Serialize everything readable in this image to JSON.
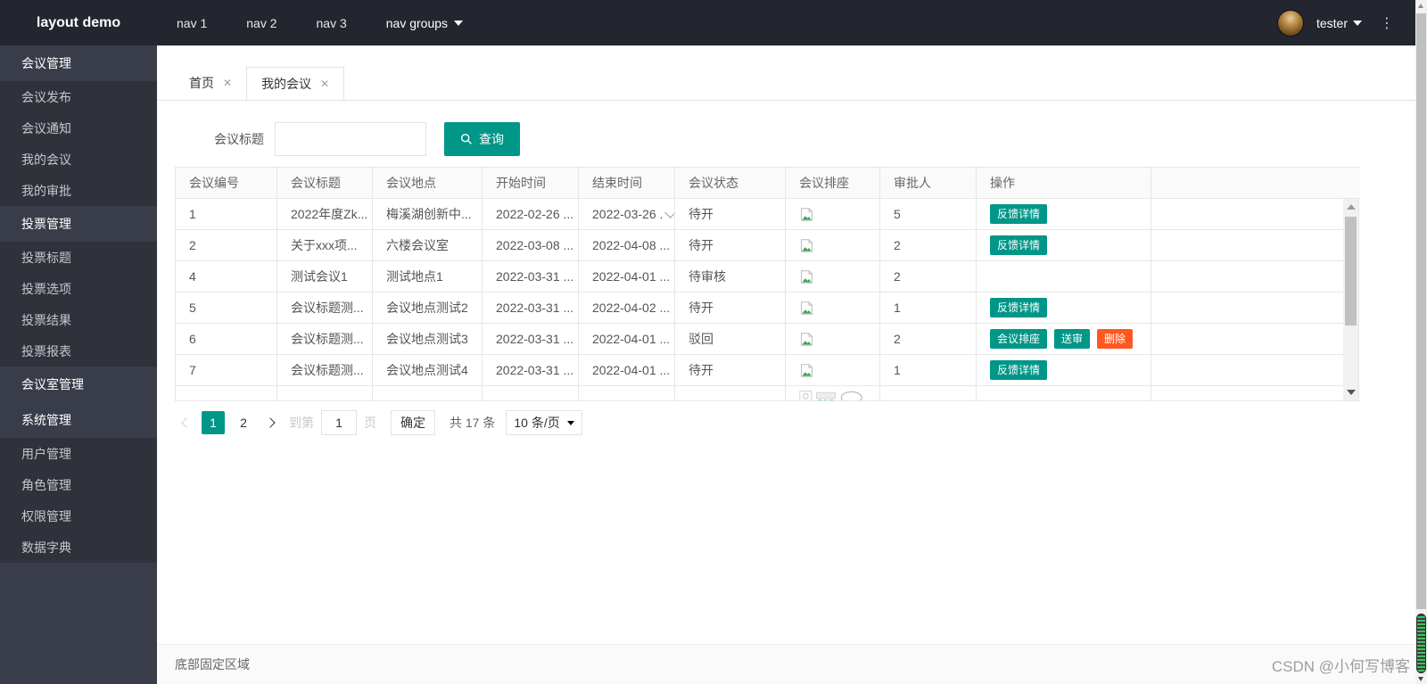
{
  "app": {
    "title": "layout demo"
  },
  "topnav": {
    "items": [
      "nav 1",
      "nav 2",
      "nav 3"
    ],
    "group_label": "nav groups",
    "user_name": "tester",
    "more_icon": "vertical-ellipsis"
  },
  "sidebar": {
    "items": [
      {
        "label": "会议管理",
        "type": "parent"
      },
      {
        "label": "会议发布",
        "type": "child"
      },
      {
        "label": "会议通知",
        "type": "child"
      },
      {
        "label": "我的会议",
        "type": "child"
      },
      {
        "label": "我的审批",
        "type": "child"
      },
      {
        "label": "投票管理",
        "type": "parent"
      },
      {
        "label": "投票标题",
        "type": "child"
      },
      {
        "label": "投票选项",
        "type": "child"
      },
      {
        "label": "投票结果",
        "type": "child"
      },
      {
        "label": "投票报表",
        "type": "child"
      },
      {
        "label": "会议室管理",
        "type": "parent"
      },
      {
        "label": "系统管理",
        "type": "parent"
      },
      {
        "label": "用户管理",
        "type": "child"
      },
      {
        "label": "角色管理",
        "type": "child"
      },
      {
        "label": "权限管理",
        "type": "child"
      },
      {
        "label": "数据字典",
        "type": "child"
      }
    ]
  },
  "tabs": [
    {
      "label": "首页",
      "active": false
    },
    {
      "label": "我的会议",
      "active": true
    }
  ],
  "search": {
    "label": "会议标题",
    "value": "",
    "button_label": "查询"
  },
  "table": {
    "columns": [
      "会议编号",
      "会议标题",
      "会议地点",
      "开始时间",
      "结束时间",
      "会议状态",
      "会议排座",
      "审批人",
      "操作",
      ""
    ],
    "rows": [
      {
        "id": "1",
        "title": "2022年度Zk...",
        "place": "梅溪湖创新中...",
        "start": "2022-02-26 ...",
        "end": "2022-03-26 .",
        "end_dropdown": true,
        "status": "待开",
        "seat_icon": "broken-image-icon",
        "approver": "5",
        "actions": [
          {
            "label": "反馈详情",
            "type": "teal"
          }
        ]
      },
      {
        "id": "2",
        "title": "关于xxx项...",
        "place": "六楼会议室",
        "start": "2022-03-08 ...",
        "end": "2022-04-08 ...",
        "end_dropdown": false,
        "status": "待开",
        "seat_icon": "broken-image-icon",
        "approver": "2",
        "actions": [
          {
            "label": "反馈详情",
            "type": "teal"
          }
        ]
      },
      {
        "id": "4",
        "title": "测试会议1",
        "place": "测试地点1",
        "start": "2022-03-31 ...",
        "end": "2022-04-01 ...",
        "end_dropdown": false,
        "status": "待审核",
        "seat_icon": "broken-image-icon",
        "approver": "2",
        "actions": []
      },
      {
        "id": "5",
        "title": "会议标题测...",
        "place": "会议地点测试2",
        "start": "2022-03-31 ...",
        "end": "2022-04-02 ...",
        "end_dropdown": false,
        "status": "待开",
        "seat_icon": "broken-image-icon",
        "approver": "1",
        "actions": [
          {
            "label": "反馈详情",
            "type": "teal"
          }
        ]
      },
      {
        "id": "6",
        "title": "会议标题测...",
        "place": "会议地点测试3",
        "start": "2022-03-31 ...",
        "end": "2022-04-01 ...",
        "end_dropdown": false,
        "status": "驳回",
        "seat_icon": "broken-image-icon",
        "approver": "2",
        "actions": [
          {
            "label": "会议排座",
            "type": "teal"
          },
          {
            "label": "送审",
            "type": "teal"
          },
          {
            "label": "删除",
            "type": "danger"
          }
        ]
      },
      {
        "id": "7",
        "title": "会议标题测...",
        "place": "会议地点测试4",
        "start": "2022-03-31 ...",
        "end": "2022-04-01 ...",
        "end_dropdown": false,
        "status": "待开",
        "seat_icon": "broken-image-icon",
        "approver": "1",
        "actions": [
          {
            "label": "反馈详情",
            "type": "teal"
          }
        ]
      }
    ],
    "partial_row": {
      "seat_image": "seating-chart-image"
    }
  },
  "pagination": {
    "pages": [
      "1",
      "2"
    ],
    "active_page": "1",
    "goto_label": "到第",
    "goto_value": "1",
    "page_unit_label": "页",
    "confirm_label": "确定",
    "total_label": "共 17 条",
    "per_page_label": "10 条/页"
  },
  "footer": {
    "label": "底部固定区域",
    "watermark": "CSDN @小何写博客"
  },
  "colors": {
    "accent_teal": "#009688",
    "danger_orange": "#FF5722",
    "header_bg": "#23262E",
    "sidebar_bg": "#393D49",
    "sidebar_child_bg": "#2F323B"
  }
}
